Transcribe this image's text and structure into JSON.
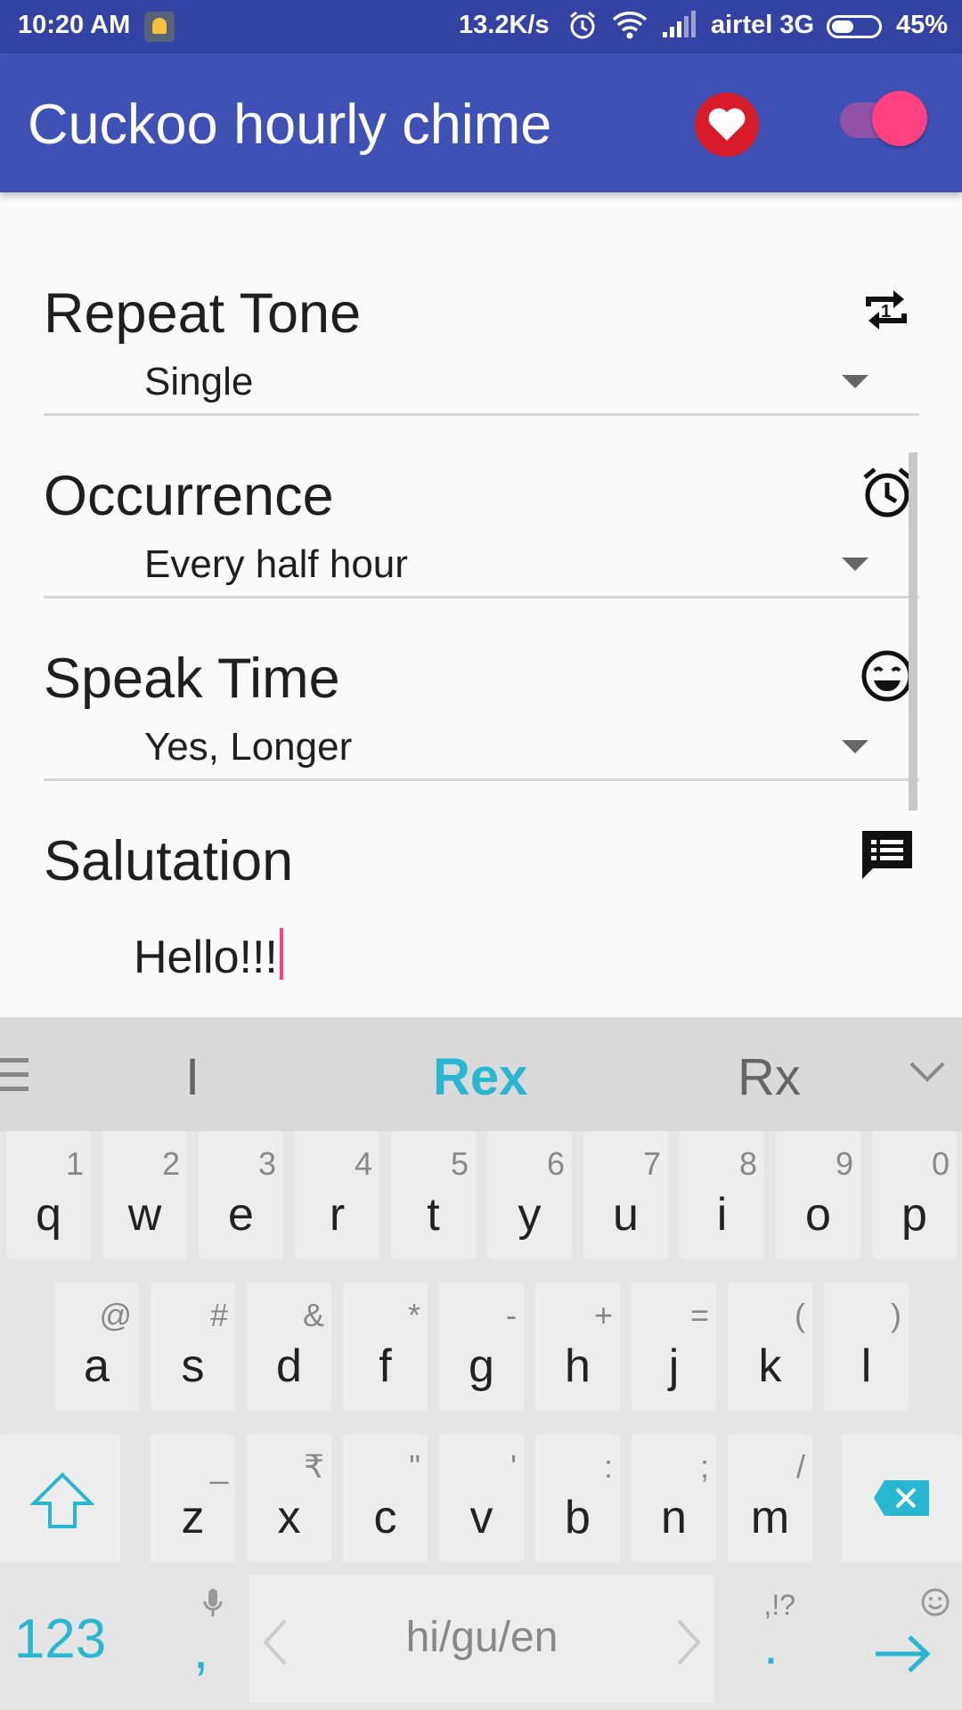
{
  "status_bar": {
    "time": "10:20 AM",
    "speed": "13.2K/s",
    "carrier": "airtel 3G",
    "battery": "45%"
  },
  "app_bar": {
    "title": "Cuckoo hourly chime",
    "toggle_on": true
  },
  "settings": [
    {
      "title": "Repeat Tone",
      "value": "Single",
      "icon": "repeat-one-icon"
    },
    {
      "title": "Occurrence",
      "value": "Every half hour",
      "icon": "alarm-clock-icon"
    },
    {
      "title": "Speak Time",
      "value": "Yes, Longer",
      "icon": "smiley-icon"
    }
  ],
  "salutation": {
    "title": "Salutation",
    "value": "Hello!!!",
    "icon": "message-list-icon"
  },
  "keyboard": {
    "suggestions": [
      "I",
      "Rex",
      "Rx"
    ],
    "row1": [
      {
        "ch": "q",
        "hint": "1"
      },
      {
        "ch": "w",
        "hint": "2"
      },
      {
        "ch": "e",
        "hint": "3"
      },
      {
        "ch": "r",
        "hint": "4"
      },
      {
        "ch": "t",
        "hint": "5"
      },
      {
        "ch": "y",
        "hint": "6"
      },
      {
        "ch": "u",
        "hint": "7"
      },
      {
        "ch": "i",
        "hint": "8"
      },
      {
        "ch": "o",
        "hint": "9"
      },
      {
        "ch": "p",
        "hint": "0"
      }
    ],
    "row2": [
      {
        "ch": "a",
        "hint": "@"
      },
      {
        "ch": "s",
        "hint": "#"
      },
      {
        "ch": "d",
        "hint": "&"
      },
      {
        "ch": "f",
        "hint": "*"
      },
      {
        "ch": "g",
        "hint": "-"
      },
      {
        "ch": "h",
        "hint": "+"
      },
      {
        "ch": "j",
        "hint": "="
      },
      {
        "ch": "k",
        "hint": "("
      },
      {
        "ch": "l",
        "hint": ")"
      }
    ],
    "row3": [
      {
        "ch": "z",
        "hint": "_"
      },
      {
        "ch": "x",
        "hint": "₹"
      },
      {
        "ch": "c",
        "hint": "\""
      },
      {
        "ch": "v",
        "hint": "'"
      },
      {
        "ch": "b",
        "hint": ":"
      },
      {
        "ch": "n",
        "hint": ";"
      },
      {
        "ch": "m",
        "hint": "/"
      }
    ],
    "num_key": "123",
    "comma_key": ",",
    "space_label": "hi/gu/en",
    "period_key": ".",
    "period_hint": ",!?",
    "accent_color": "#29b6d1"
  }
}
